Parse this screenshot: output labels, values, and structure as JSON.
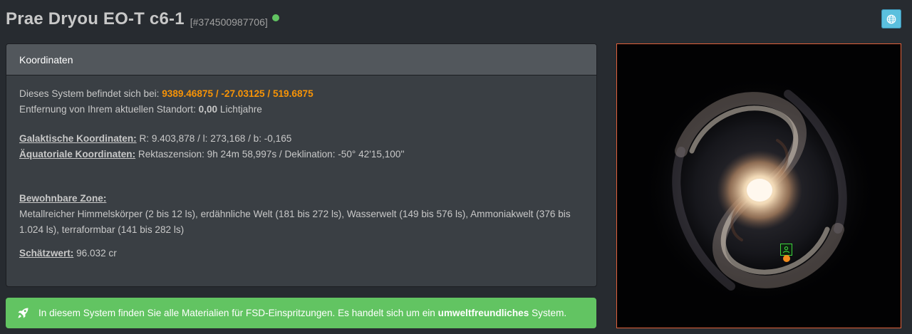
{
  "system": {
    "name": "Prae Dryou EO-T c6-1",
    "id": "[#374500987706]",
    "status_color": "#62c462"
  },
  "globe_button": {
    "icon": "globe-icon"
  },
  "coordinates_panel": {
    "heading": "Koordinaten",
    "location_prefix": "Dieses System befindet sich bei:",
    "location_value": "9389.46875 / -27.03125 / 519.6875",
    "distance_prefix": "Entfernung von Ihrem aktuellen Standort:",
    "distance_value": "0,00",
    "distance_unit": "Lichtjahre",
    "galactic_label": "Galaktische Koordinaten:",
    "galactic_value": "R: 9.403,878 / l: 273,168 / b: -0,165",
    "equatorial_label": "Äquatoriale Koordinaten:",
    "equatorial_value": "Rektaszension: 9h 24m 58,997s / Deklination: -50° 42'15,100''",
    "habitable_label": "Bewohnbare Zone:",
    "habitable_value": "Metallreicher Himmelskörper (2 bis 12 ls), erdähnliche Welt (181 bis 272 ls), Wasserwelt (149 bis 576 ls), Ammoniakwelt (376 bis 1.024 ls), terraformbar (141 bis 282 ls)",
    "estimate_label": "Schätzwert:",
    "estimate_value": "96.032 cr"
  },
  "alert": {
    "icon": "rocket-icon",
    "text_before": "In diesem System finden Sie alle Materialien für FSD-Einspritzungen. Es handelt sich um ein",
    "text_bold": "umweltfreundliches",
    "text_after": "System."
  },
  "galaxy_map": {
    "marker_icon": "commander-icon",
    "frame_color": "#e0603a",
    "marker_color": "#3cd43c",
    "dot_color": "#f08a1c"
  }
}
